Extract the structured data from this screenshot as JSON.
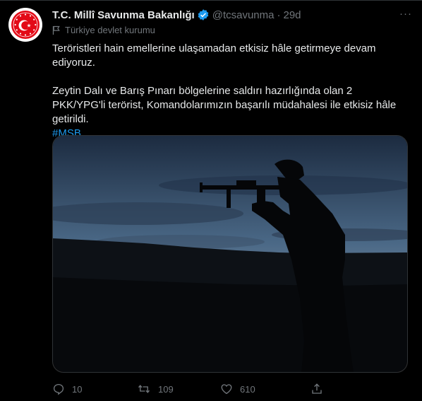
{
  "tweet": {
    "author_name": "T.C. Millî Savunma Bakanlığı",
    "handle": "@tcsavunma",
    "separator": "·",
    "time": "29d",
    "more_label": "···",
    "account_label": "Türkiye devlet kurumu",
    "text_line1": "Teröristleri hain emellerine ulaşamadan etkisiz hâle getirmeye devam ediyoruz.",
    "text_line2": "Zeytin Dalı ve Barış Pınarı bölgelerine saldırı hazırlığında olan 2 PKK/YPG'li terörist, Komandolarımızın başarılı müdahalesi ile etkisiz hâle getirildi.",
    "hashtag": "#MSB"
  },
  "actions": {
    "replies": "10",
    "retweets": "109",
    "likes": "610"
  },
  "icons": {
    "verified": "verified-badge-icon",
    "label": "flag-icon",
    "reply": "reply-icon",
    "retweet": "retweet-icon",
    "like": "heart-icon",
    "share": "share-icon"
  },
  "colors": {
    "background": "#000000",
    "text": "#e7e9ea",
    "secondary": "#71767b",
    "accent": "#1d9bf0",
    "avatar_red": "#e30a17"
  }
}
